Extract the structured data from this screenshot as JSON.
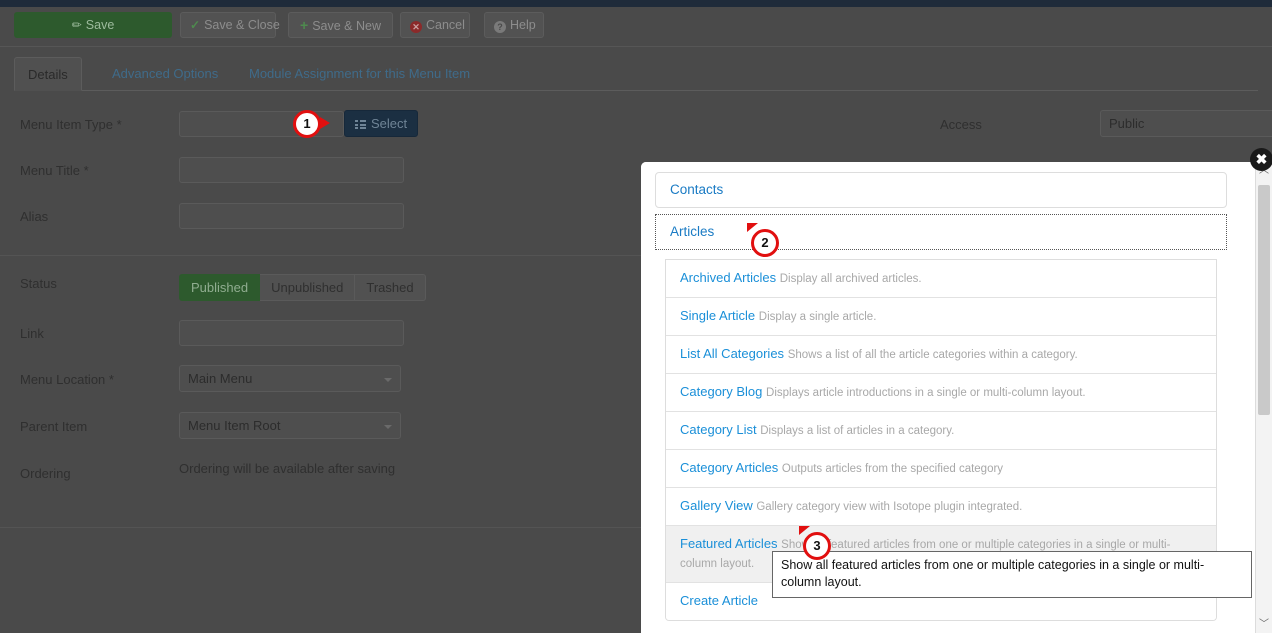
{
  "toolbar": {
    "buttons": [
      {
        "label": "Save",
        "icon": "save-icon",
        "name": "save-button"
      },
      {
        "label": "Save & Close",
        "icon": "check-icon",
        "name": "save-close-button"
      },
      {
        "label": "Save & New",
        "icon": "plus-icon",
        "name": "save-new-button"
      },
      {
        "label": "Cancel",
        "icon": "cancel-icon",
        "name": "cancel-button"
      },
      {
        "label": "Help",
        "icon": "help-icon",
        "name": "help-button"
      }
    ]
  },
  "tabs": [
    {
      "label": "Details",
      "active": true
    },
    {
      "label": "Advanced Options",
      "active": false
    },
    {
      "label": "Module Assignment for this Menu Item",
      "active": false
    }
  ],
  "form": {
    "menu_item_type_label": "Menu Item Type *",
    "menu_item_type_value": "",
    "select_button": "Select",
    "menu_title_label": "Menu Title *",
    "menu_title_value": "",
    "alias_label": "Alias",
    "alias_value": "",
    "status_label": "Status",
    "status_options": [
      "Published",
      "Unpublished",
      "Trashed"
    ],
    "status_selected": "Published",
    "link_label": "Link",
    "link_value": "",
    "menu_location_label": "Menu Location *",
    "menu_location_value": "Main Menu",
    "parent_item_label": "Parent Item",
    "parent_item_value": "Menu Item Root",
    "ordering_label": "Ordering",
    "ordering_value": "Ordering will be available after saving",
    "access_label": "Access",
    "access_value": "Public"
  },
  "modal": {
    "close_label": "✖",
    "accordions": [
      {
        "label": "Contacts",
        "expanded": false
      },
      {
        "label": "Articles",
        "expanded": true,
        "focused": true
      }
    ],
    "items": [
      {
        "title": "Archived Articles",
        "desc": "Display all archived articles.",
        "highlighted": false
      },
      {
        "title": "Single Article",
        "desc": "Display a single article.",
        "highlighted": false
      },
      {
        "title": "List All Categories",
        "desc": "Shows a list of all the article categories within a category.",
        "highlighted": false
      },
      {
        "title": "Category Blog",
        "desc": "Displays article introductions in a single or multi-column layout.",
        "highlighted": false
      },
      {
        "title": "Category List",
        "desc": "Displays a list of articles in a category.",
        "highlighted": false
      },
      {
        "title": "Category Articles",
        "desc": "Outputs articles from the specified category",
        "highlighted": false
      },
      {
        "title": "Gallery View",
        "desc": "Gallery category view with Isotope plugin integrated.",
        "highlighted": false
      },
      {
        "title": "Featured Articles",
        "desc": "Show all featured articles from one or multiple categories in a single or multi-column layout.",
        "highlighted": true
      },
      {
        "title": "Create Article",
        "desc": "",
        "highlighted": false
      }
    ],
    "scrollbar": {
      "up": "︿",
      "down": "﹀"
    }
  },
  "tooltip": {
    "text": "Show all featured articles from one or multiple categories in a single or multi-column layout."
  },
  "badges": [
    {
      "number": "1"
    },
    {
      "number": "2"
    },
    {
      "number": "3"
    }
  ],
  "colors": {
    "accent_blue": "#1a8fd8",
    "save_green": "#2d5a2d",
    "badge_red": "#e10f0f",
    "select_navy": "#1b2f42"
  }
}
